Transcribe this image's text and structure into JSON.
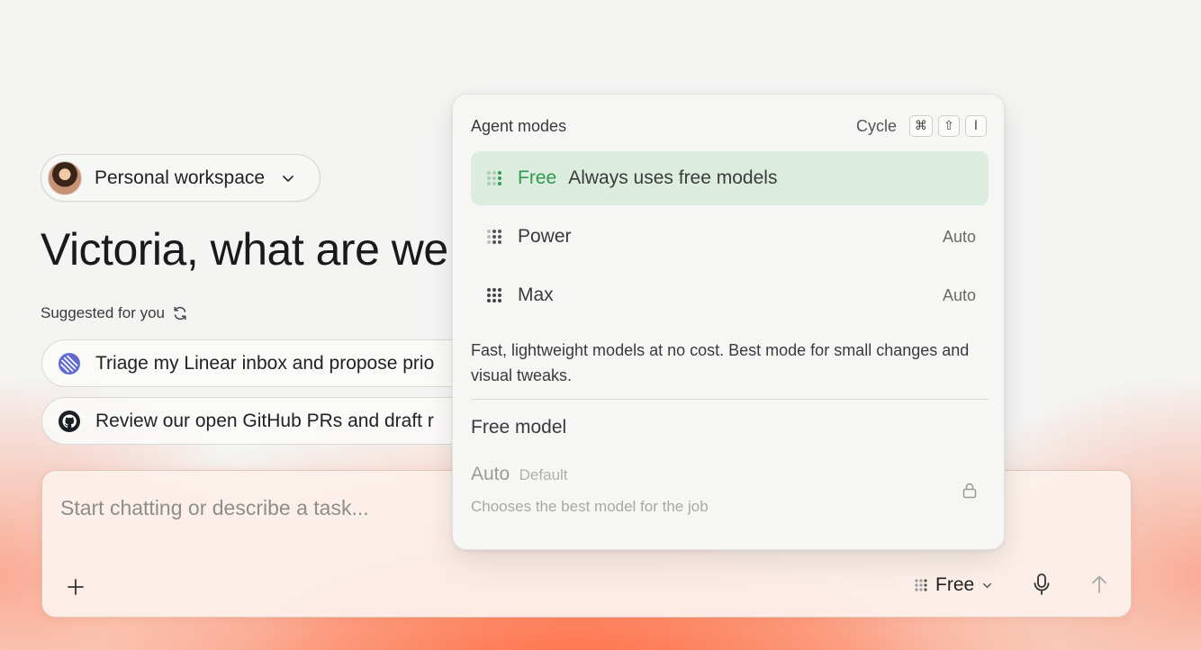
{
  "workspace": {
    "label": "Personal workspace"
  },
  "greeting": "Victoria, what are we",
  "suggested": {
    "label": "Suggested for you",
    "items": [
      {
        "label": "Triage my Linear inbox and propose prio",
        "icon": "linear-icon"
      },
      {
        "label": "Review our open GitHub PRs and draft r",
        "icon": "github-icon"
      }
    ]
  },
  "chat": {
    "placeholder": "Start chatting or describe a task...",
    "mode_label": "Free"
  },
  "panel": {
    "title": "Agent modes",
    "cycle_label": "Cycle",
    "cycle_keys": [
      "⌘",
      "⇧",
      "I"
    ],
    "modes": [
      {
        "name": "Free",
        "description": "Always uses free models",
        "active": true
      },
      {
        "name": "Power",
        "right": "Auto"
      },
      {
        "name": "Max",
        "right": "Auto"
      }
    ],
    "mode_description": "Fast, lightweight models at no cost. Best mode for small changes and visual tweaks.",
    "model_heading": "Free model",
    "model": {
      "name": "Auto",
      "tag": "Default",
      "subtitle": "Chooses the best model for the job"
    }
  },
  "colors": {
    "accent_green": "#2f9a4a",
    "active_row_bg": "#dcede0",
    "glow": "#ff6234"
  }
}
